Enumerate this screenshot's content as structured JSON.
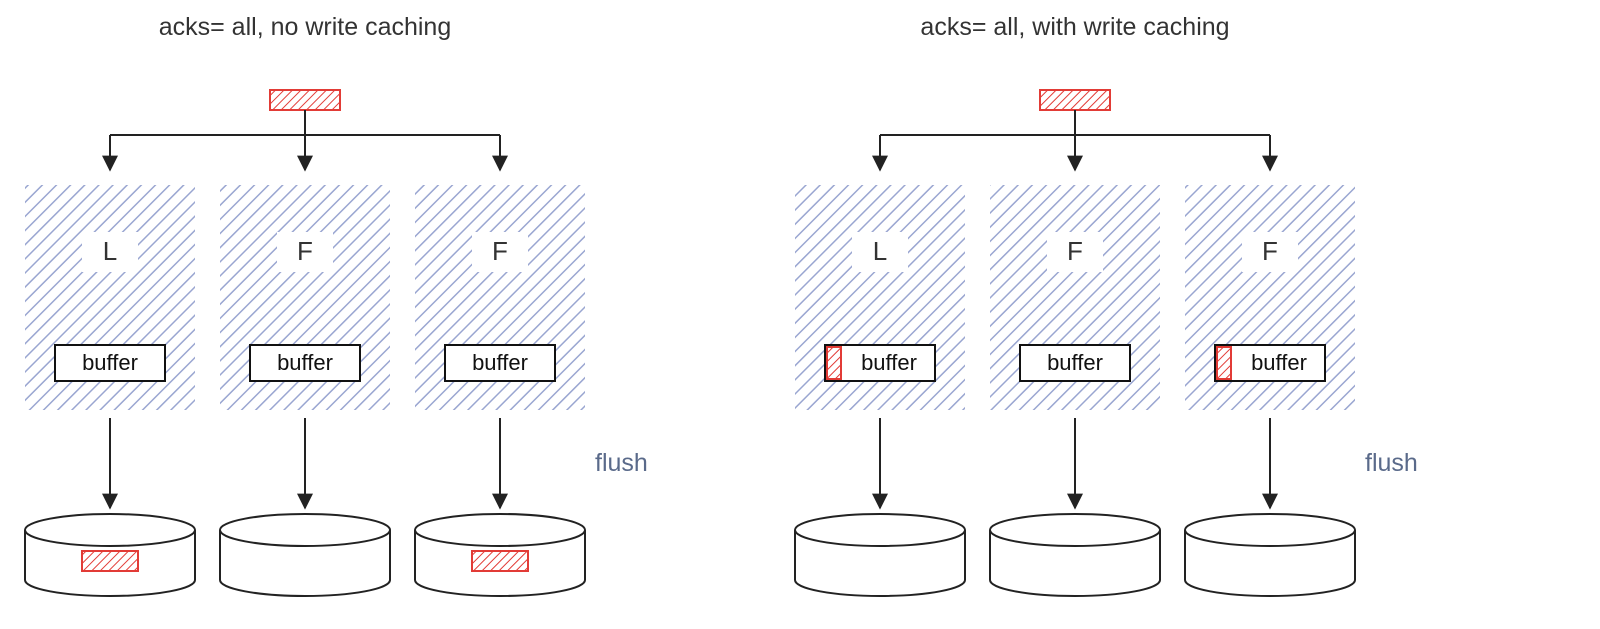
{
  "left": {
    "title": "acks= all, no write caching",
    "flush_label": "flush",
    "nodes": [
      {
        "role": "L",
        "buffer_label": "buffer",
        "buffer_has_message": false,
        "disk_has_message": true
      },
      {
        "role": "F",
        "buffer_label": "buffer",
        "buffer_has_message": false,
        "disk_has_message": false
      },
      {
        "role": "F",
        "buffer_label": "buffer",
        "buffer_has_message": false,
        "disk_has_message": true
      }
    ]
  },
  "right": {
    "title": "acks= all, with write caching",
    "flush_label": "flush",
    "nodes": [
      {
        "role": "L",
        "buffer_label": "buffer",
        "buffer_has_message": true,
        "disk_has_message": false
      },
      {
        "role": "F",
        "buffer_label": "buffer",
        "buffer_has_message": false,
        "disk_has_message": false
      },
      {
        "role": "F",
        "buffer_label": "buffer",
        "buffer_has_message": true,
        "disk_has_message": false
      }
    ]
  },
  "colors": {
    "node_hatch": "#9aa6d1",
    "msg_stroke": "#e23b36",
    "msg_fill": "#e23b36",
    "ink": "#222222"
  }
}
